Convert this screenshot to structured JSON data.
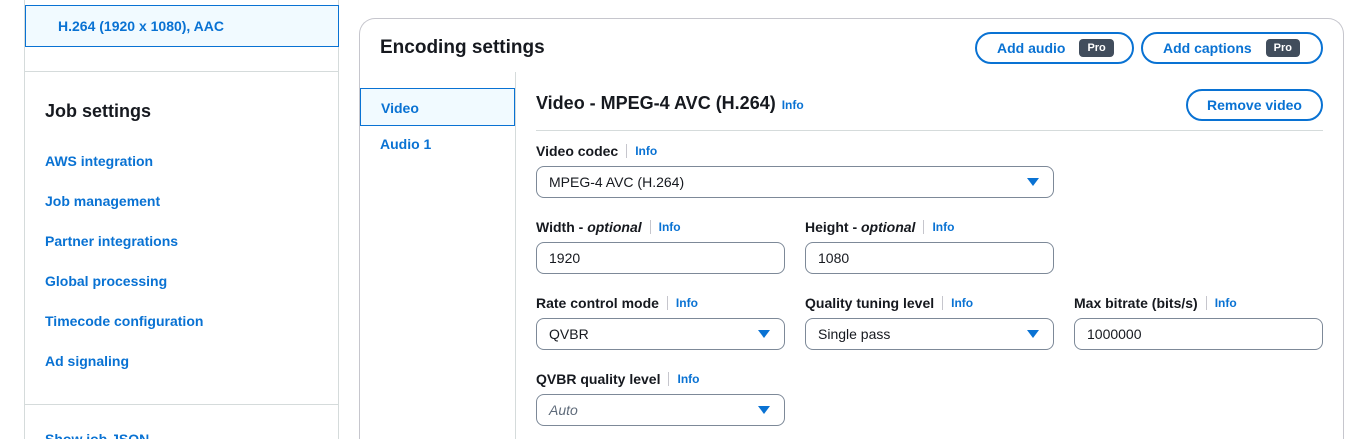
{
  "sidebar": {
    "selected_output": "H.264 (1920 x 1080), AAC",
    "job_settings_title": "Job settings",
    "links": [
      "AWS integration",
      "Job management",
      "Partner integrations",
      "Global processing",
      "Timecode configuration",
      "Ad signaling"
    ],
    "show_job_json": "Show job JSON"
  },
  "encoding": {
    "title": "Encoding settings",
    "add_audio": "Add audio",
    "add_captions": "Add captions",
    "pro_badge": "Pro",
    "tabs": [
      "Video",
      "Audio 1"
    ]
  },
  "video": {
    "title": "Video - MPEG-4 AVC (H.264)",
    "info": "Info",
    "remove_label": "Remove video",
    "codec_label": "Video codec",
    "codec_value": "MPEG-4 AVC (H.264)",
    "width_label": "Width - ",
    "width_optional": "optional",
    "width_value": "1920",
    "height_label": "Height - ",
    "height_optional": "optional",
    "height_value": "1080",
    "rate_control_label": "Rate control mode",
    "rate_control_value": "QVBR",
    "quality_tuning_label": "Quality tuning level",
    "quality_tuning_value": "Single pass",
    "max_bitrate_label": "Max bitrate (bits/s)",
    "max_bitrate_value": "1000000",
    "qvbr_level_label": "QVBR quality level",
    "qvbr_level_placeholder": "Auto"
  },
  "colors": {
    "accent": "#0972d3",
    "selected_bg": "#f1faff",
    "badge_bg": "#414d5c"
  }
}
